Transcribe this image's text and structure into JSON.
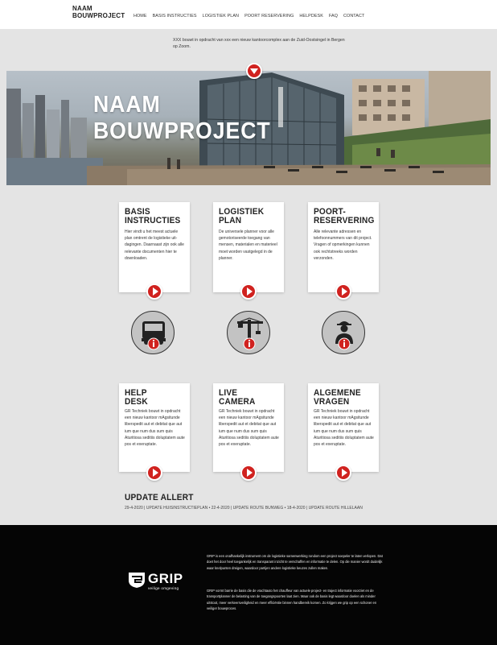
{
  "header": {
    "logo_line1": "NAAM",
    "logo_line2": "BOUWPROJECT",
    "nav": [
      "HOME",
      "BASIS INSTRUCTIES",
      "LOGISTIEK PLAN",
      "POORT RESERVERING",
      "HELPDESK",
      "FAQ",
      "CONTACT"
    ]
  },
  "intro": {
    "text": "XXX bouwt in opdracht van xxx een nieuw kantoorcomplex aan de Zuid-Oostsingel in Bergen op Zoom."
  },
  "hero": {
    "title_line1": "NAAM",
    "title_line2": "BOUWPROJECT"
  },
  "cards_top": [
    {
      "title1": "BASIS",
      "title2": "INSTRUCTIES",
      "text": "Hier vindt u het meest actuele plan omtrent de logistieke uit-dagingen. Daarnaast zijn ook alle relevante documenten hier te downloaden."
    },
    {
      "title1": "LOGISTIEK",
      "title2": "PLAN",
      "text": "De universele planner voor alle gemotoriseerde toegang van mensen, materialen en materieel moet worden vastgelegd in de planner."
    },
    {
      "title1": "POORT-",
      "title2": "RESERVERING",
      "text": "Alle relevante adressen en telefoonnummers van dit project. Vragen of opmerkingen kunnen ook rechtstreeks worden verzonden."
    }
  ],
  "cards_bottom": [
    {
      "title1": "HELP",
      "title2": "DESK",
      "text": "GR Techniek bouwt in opdracht een nieuw kantoor mAgsitunde liberspedit aut et debitat que aut ium que num dus sum quis Aturitiosa seditiis doluptatem aute pos et exeruptate."
    },
    {
      "title1": "LIVE",
      "title2": "CAMERA",
      "text": "GR Techniek bouwt in opdracht een nieuw kantoor mAgsitunde liberspedit aut et debitat que aut ium que num dus sum quis Aturitiosa seditiis doluptatem aute pos et exeruptate."
    },
    {
      "title1": "ALGEMENE",
      "title2": "VRAGEN",
      "text": "GR Techniek bouwt in opdracht een nieuw kantoor mAgsitunde liberspedit aut et debitat que aut ium que num dus sum quis Aturitiosa seditiis doluptatem aute pos et exeruptate."
    }
  ],
  "update": {
    "title": "UPDATE ALLERT",
    "line": "29-4-2020 | UPDATE HUISINSTRUCTIEPLAN • 22-4-2020 | UPDATE ROUTE BUNWEG • 18-4-2020 | UPDATE ROUTE HILLELAAN"
  },
  "footer": {
    "brand": "GRIP",
    "tagline": "veilige omgeving",
    "para1": "GRIP is een onafhankelijk instrument om de logistieke samenwerking rondom een project soepeler te laten verlopen. Dat doet het door heel toegankelijk en transparant inzicht te verschaffen en informatie te delen. Op die manier wordt duidelijk waar knelpunten dreigen, waardoor partijen andere logistieke keuzes zullen maken.",
    "para2": "GRIP vormt barrie de basis die de vrachtauto het chauffeur van actuele project- en traject informatie voorziet en de transportplanner de belasting van de toegangspoorten laat zien. Maar ook de basis legt waardoor doelen als minder uitstoot, meer verkeersveiligheid en meer efficiëntie binnen handbereik komen. Zo krijgen we grip op een schoner en veiliger bouwproces."
  },
  "icons": [
    "truck-icon",
    "crane-icon",
    "worker-icon",
    "info-badge-icon"
  ],
  "colors": {
    "accent": "#d0221f",
    "footer_bg": "#050505",
    "page_bg": "#e4e4e4"
  }
}
